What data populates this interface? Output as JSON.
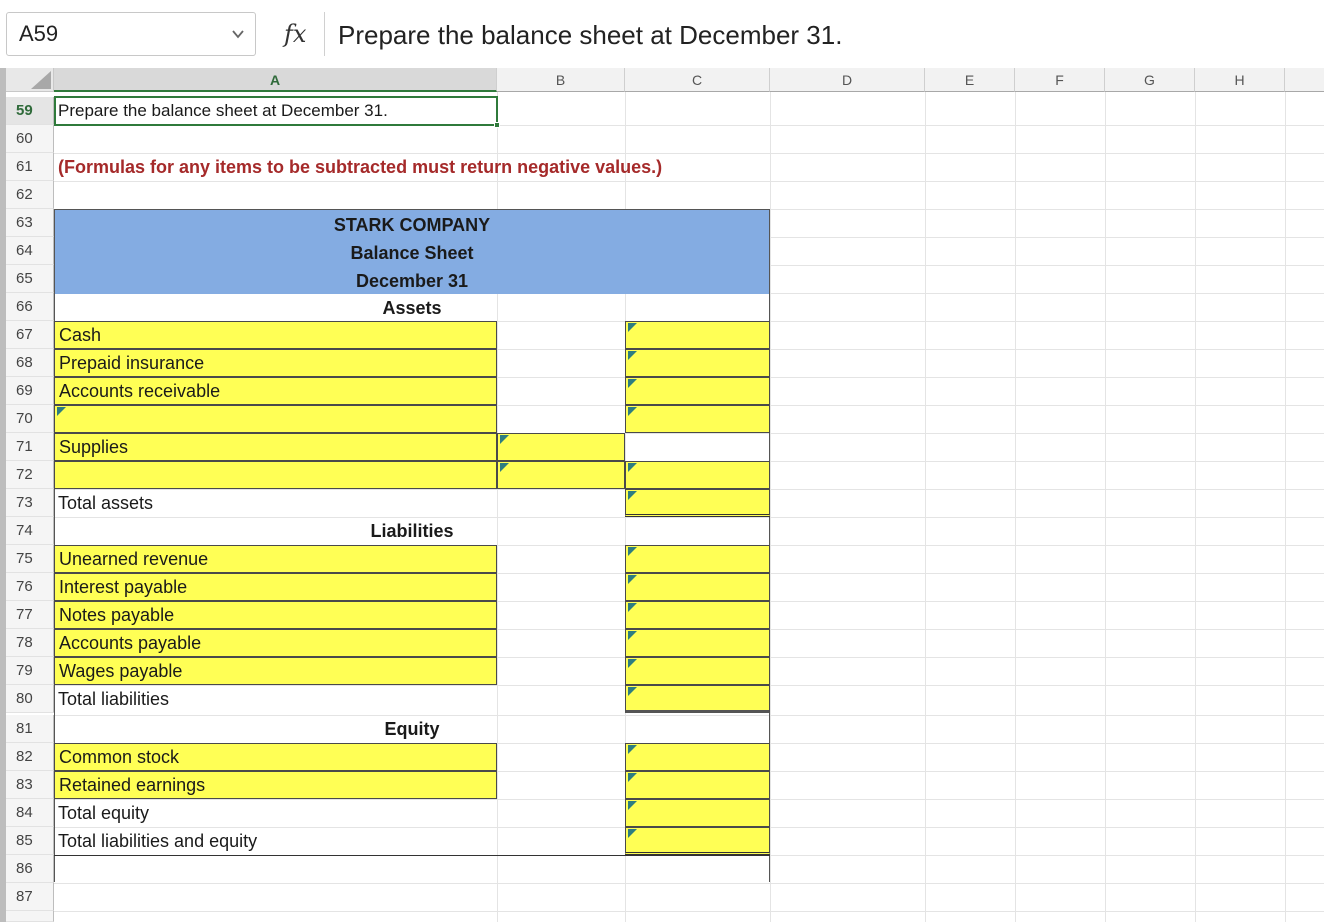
{
  "formula_bar": {
    "cell_ref": "A59",
    "fx_label": "fx",
    "formula": "Prepare the balance sheet at December 31."
  },
  "columns": [
    "A",
    "B",
    "C",
    "D",
    "E",
    "F",
    "G",
    "H"
  ],
  "rows": [
    "59",
    "60",
    "61",
    "62",
    "63",
    "64",
    "65",
    "66",
    "67",
    "68",
    "69",
    "70",
    "71",
    "72",
    "73",
    "74",
    "75",
    "76",
    "77",
    "78",
    "79",
    "80",
    "81",
    "82",
    "83",
    "84",
    "85",
    "86",
    "87"
  ],
  "content": {
    "a59": "Prepare the balance sheet at December 31.",
    "note": "(Formulas for any items to be subtracted must return negative values.)"
  },
  "header": {
    "company": "STARK COMPANY",
    "statement": "Balance Sheet",
    "date": "December 31"
  },
  "sections": {
    "assets": "Assets",
    "liabilities": "Liabilities",
    "equity": "Equity"
  },
  "labels": {
    "cash": "Cash",
    "prepaid_insurance": "Prepaid insurance",
    "accounts_receivable": "Accounts receivable",
    "blank_70": "",
    "supplies": "Supplies",
    "blank_72": "",
    "total_assets": "Total assets",
    "unearned_revenue": "Unearned revenue",
    "interest_payable": "Interest payable",
    "notes_payable": "Notes payable",
    "accounts_payable": "Accounts payable",
    "wages_payable": "Wages payable",
    "total_liabilities": "Total liabilities",
    "common_stock": "Common stock",
    "retained_earnings": "Retained earnings",
    "total_equity": "Total equity",
    "total_liabilities_equity": "Total liabilities and equity"
  },
  "colors": {
    "input_fill": "#ffff55",
    "header_fill": "#84ace2",
    "note_text": "#a52a2a",
    "selection": "#2f7a3b"
  }
}
